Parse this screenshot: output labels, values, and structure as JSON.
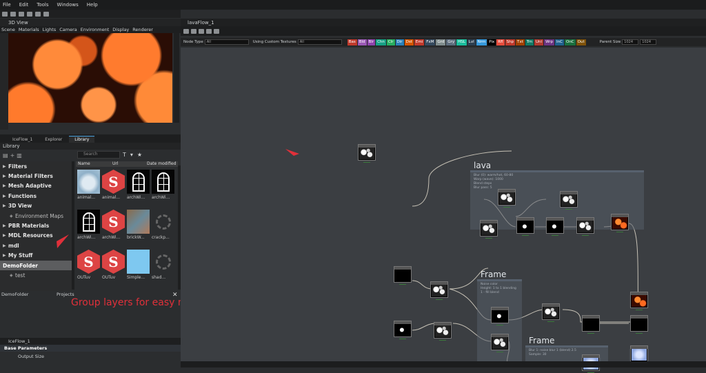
{
  "menubar": {
    "items": [
      "File",
      "Edit",
      "Tools",
      "Windows",
      "Help"
    ]
  },
  "view3d": {
    "title": "3D View",
    "menu": [
      "Scene",
      "Materials",
      "Lights",
      "Camera",
      "Environment",
      "Display",
      "Renderer"
    ]
  },
  "library": {
    "tabs": [
      "IceFlow_1",
      "Explorer",
      "Library"
    ],
    "title": "Library",
    "search_placeholder": "Search",
    "columns": [
      "Name",
      "Url",
      "Date modified"
    ],
    "tree": [
      {
        "label": "Filters",
        "type": "group"
      },
      {
        "label": "Material Filters",
        "type": "group"
      },
      {
        "label": "Mesh Adaptive",
        "type": "group"
      },
      {
        "label": "Functions",
        "type": "group"
      },
      {
        "label": "3D View",
        "type": "group"
      },
      {
        "label": "Environment Maps",
        "type": "sub"
      },
      {
        "label": "PBR Materials",
        "type": "group"
      },
      {
        "label": "MDL Resources",
        "type": "group"
      },
      {
        "label": "mdl",
        "type": "group"
      },
      {
        "label": "My Stuff",
        "type": "group"
      },
      {
        "label": "DemoFolder",
        "type": "selected"
      },
      {
        "label": "test",
        "type": "sub"
      }
    ],
    "grid": [
      {
        "label": "animal...",
        "kind": "sphere"
      },
      {
        "label": "animal...",
        "kind": "substance"
      },
      {
        "label": "archWi...",
        "kind": "arch"
      },
      {
        "label": "archWi...",
        "kind": "arch"
      },
      {
        "label": "archWi...",
        "kind": "arch"
      },
      {
        "label": "archWi...",
        "kind": "substance"
      },
      {
        "label": "brickW...",
        "kind": "brick"
      },
      {
        "label": "crackp...",
        "kind": "spinner"
      },
      {
        "label": "OUTuv",
        "kind": "substance"
      },
      {
        "label": "OUTuv",
        "kind": "substance"
      },
      {
        "label": "Simple...",
        "kind": "blue"
      },
      {
        "label": "shad...",
        "kind": "spinner"
      }
    ],
    "bottom_labels": [
      "DemoFolder",
      "Projects"
    ]
  },
  "caption": "Group layers for easy management",
  "properties": {
    "tab": "IceFlow_1",
    "section": "Base Parameters",
    "field": "Output Size"
  },
  "graph": {
    "tab": "lavaFlow_1",
    "toolbar": {
      "node_type_label": "Node Type",
      "node_type_value": "All",
      "using_label": "Using Custom Textures",
      "using_value": "All",
      "channels": [
        {
          "label": "Bas",
          "color": "#c0392b"
        },
        {
          "label": "Bld",
          "color": "#9b59b6"
        },
        {
          "label": "Blr",
          "color": "#8e44ad"
        },
        {
          "label": "Chn",
          "color": "#16a085"
        },
        {
          "label": "Clr",
          "color": "#27ae60"
        },
        {
          "label": "Dir",
          "color": "#2980b9"
        },
        {
          "label": "Dst",
          "color": "#d35400"
        },
        {
          "label": "Emi",
          "color": "#c0392b"
        },
        {
          "label": "FxM",
          "color": "#34495e"
        },
        {
          "label": "Grd",
          "color": "#7f8c8d"
        },
        {
          "label": "Gry",
          "color": "#5d6d7e"
        },
        {
          "label": "HSL",
          "color": "#1abc9c"
        },
        {
          "label": "Lvl",
          "color": "#2c3e50"
        },
        {
          "label": "Nrm",
          "color": "#3498db"
        },
        {
          "label": "Pix",
          "color": "#000000"
        },
        {
          "label": "Rfl",
          "color": "#e74c3c"
        },
        {
          "label": "Shp",
          "color": "#c0392b"
        },
        {
          "label": "Txt",
          "color": "#a04000"
        },
        {
          "label": "Trn",
          "color": "#117864"
        },
        {
          "label": "Uni",
          "color": "#b03a2e"
        },
        {
          "label": "Wrp",
          "color": "#6c3483"
        },
        {
          "label": "InC",
          "color": "#1f618d"
        },
        {
          "label": "OnC",
          "color": "#196f3d"
        },
        {
          "label": "Out",
          "color": "#7e5109"
        }
      ],
      "parent_size_label": "Parent Size",
      "size_w": "1024",
      "size_h": "1024"
    },
    "frames": [
      {
        "title": "lava",
        "desc": [
          "Blur (0): warm/hot, 60-80",
          "Warp (wave): 1000",
          "Blend steps",
          "",
          "Blur pass: 5"
        ]
      },
      {
        "title": "Frame",
        "desc": [
          "Noise color",
          "Height: 1 to 1 blending",
          "1 - fill blend"
        ]
      },
      {
        "title": "Frame",
        "desc": [
          "Blur 1: noise blur 1 (blend) 2.5",
          "Sample: 30"
        ]
      }
    ]
  }
}
